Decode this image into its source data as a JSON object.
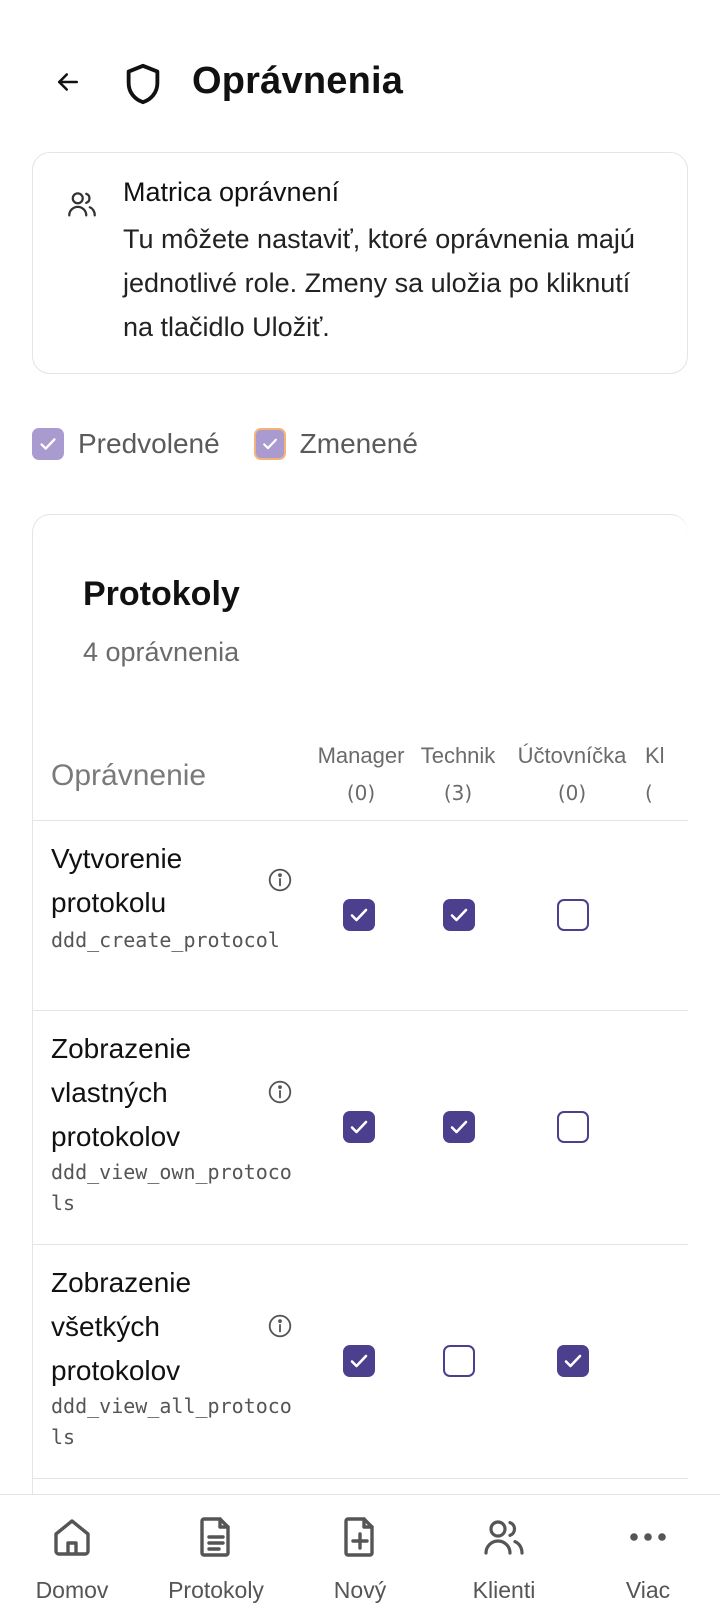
{
  "header": {
    "title": "Oprávnenia"
  },
  "info": {
    "title": "Matrica oprávnení",
    "body": "Tu môžete nastaviť, ktoré oprávnenia majú jednotlivé role. Zmeny sa uložia po kliknutí na tlačidlo Uložiť."
  },
  "legend": {
    "default_label": "Predvolené",
    "changed_label": "Zmenené"
  },
  "colors": {
    "accent": "#4b3f8e",
    "legend_default": "#a99bd0",
    "legend_changed_border": "#f3b27a"
  },
  "section": {
    "title": "Protokoly",
    "count": "4 oprávnenia",
    "column_header": "Oprávnenie",
    "roles": [
      {
        "name": "Manager",
        "count": "(0)"
      },
      {
        "name": "Technik",
        "count": "(3)"
      },
      {
        "name": "Účtovníčka",
        "count": "(0)"
      },
      {
        "name": "Kl",
        "count": "("
      }
    ],
    "rows": [
      {
        "name": "Vytvorenie protokolu",
        "code": "ddd_create_protocol",
        "checks": [
          true,
          true,
          false
        ]
      },
      {
        "name": "Zobrazenie vlastných protokolov",
        "code": "ddd_view_own_protocols",
        "checks": [
          true,
          true,
          false
        ]
      },
      {
        "name": "Zobrazenie všetkých protokolov",
        "code": "ddd_view_all_protocols",
        "checks": [
          true,
          false,
          true
        ]
      }
    ]
  },
  "nav": {
    "items": [
      {
        "label": "Domov",
        "icon": "home-icon"
      },
      {
        "label": "Protokoly",
        "icon": "document-icon"
      },
      {
        "label": "Nový",
        "icon": "new-document-icon"
      },
      {
        "label": "Klienti",
        "icon": "users-icon"
      },
      {
        "label": "Viac",
        "icon": "more-icon"
      }
    ]
  }
}
